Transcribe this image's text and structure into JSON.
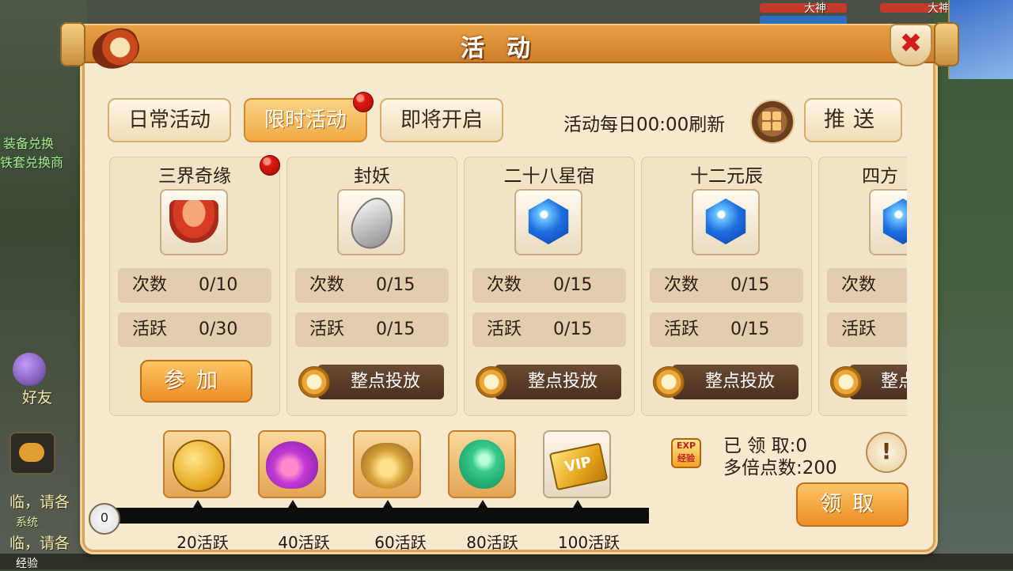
{
  "background": {
    "left_text_1": "装备兑换",
    "left_text_2": "铁套兑换商",
    "friend_label": "好友",
    "chat_line_1": "临，请各",
    "chat_line_2": "临，请各",
    "system_tag": "系统",
    "top_name_1": "大神",
    "top_name_2": "大神",
    "bottom_label": "经验"
  },
  "dialog": {
    "title": "活动"
  },
  "tabs": [
    {
      "label": "日常活动",
      "active": false
    },
    {
      "label": "限时活动",
      "active": true
    },
    {
      "label": "即将开启",
      "active": false
    }
  ],
  "header": {
    "refresh_text": "活动每日00:00刷新",
    "push_label": "推送"
  },
  "cards": [
    {
      "name": "三界奇缘",
      "icon": "bowl-icon",
      "count_label": "次数",
      "count": "0/10",
      "active_label": "活跃",
      "active": "0/30",
      "action": "参加",
      "has_red_dot": true
    },
    {
      "name": "封妖",
      "icon": "leaf-icon",
      "count_label": "次数",
      "count": "0/15",
      "active_label": "活跃",
      "active": "0/15",
      "action": "整点投放"
    },
    {
      "name": "二十八星宿",
      "icon": "blue-gem-icon",
      "count_label": "次数",
      "count": "0/15",
      "active_label": "活跃",
      "active": "0/15",
      "action": "整点投放"
    },
    {
      "name": "十二元辰",
      "icon": "blue-gem-icon",
      "count_label": "次数",
      "count": "0/15",
      "active_label": "活跃",
      "active": "0/15",
      "action": "整点投放"
    },
    {
      "name": "四方",
      "icon": "blue-gem-icon",
      "count_label": "次数",
      "active_label": "活跃",
      "action": "整点"
    }
  ],
  "rewards": [
    {
      "icon": "gold-coin-icon",
      "milestone": "20活跃"
    },
    {
      "icon": "purple-bag-icon",
      "milestone": "40活跃"
    },
    {
      "icon": "gold-bag-icon",
      "milestone": "60活跃"
    },
    {
      "icon": "jade-icon",
      "milestone": "80活跃"
    },
    {
      "icon": "vip-card-icon",
      "milestone": "100活跃",
      "label": "VIP"
    }
  ],
  "progress": {
    "current": "0",
    "value": 0,
    "max": 100
  },
  "claim": {
    "exp_label": "EXP 经验",
    "claimed_label": "已 领 取:",
    "claimed_value": "0",
    "multiplier_label": "多倍点数:",
    "multiplier_value": "200",
    "info_label": "!",
    "claim_button": "领取"
  },
  "colors": {
    "accent_orange": "#ec8e26",
    "panel_bg": "#f7e8d0",
    "alert_red": "#e01a10",
    "timed_button_brown": "#4a301f"
  }
}
